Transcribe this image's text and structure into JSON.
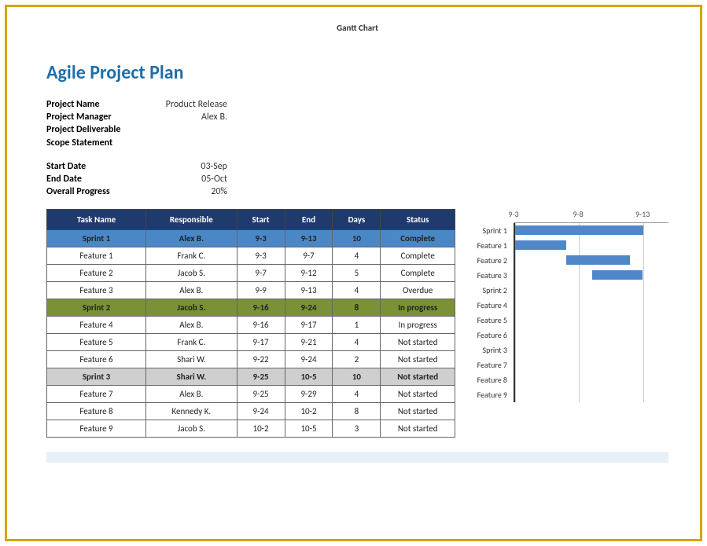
{
  "doc_title": "Gantt Chart",
  "heading": "Agile Project Plan",
  "meta1": [
    {
      "label": "Project Name",
      "value": "Product Release"
    },
    {
      "label": "Project Manager",
      "value": "Alex B."
    },
    {
      "label": "Project Deliverable",
      "value": ""
    },
    {
      "label": "Scope Statement",
      "value": ""
    }
  ],
  "meta2": [
    {
      "label": "Start Date",
      "value": "03-Sep"
    },
    {
      "label": "End Date",
      "value": "05-Oct"
    },
    {
      "label": "Overall Progress",
      "value": "20%"
    }
  ],
  "table": {
    "headers": [
      "Task Name",
      "Responsible",
      "Start",
      "End",
      "Days",
      "Status"
    ],
    "rows": [
      {
        "style": "blue",
        "cells": [
          "Sprint 1",
          "Alex B.",
          "9-3",
          "9-13",
          "10",
          "Complete"
        ]
      },
      {
        "style": "",
        "cells": [
          "Feature 1",
          "Frank C.",
          "9-3",
          "9-7",
          "4",
          "Complete"
        ]
      },
      {
        "style": "",
        "cells": [
          "Feature 2",
          "Jacob S.",
          "9-7",
          "9-12",
          "5",
          "Complete"
        ]
      },
      {
        "style": "",
        "cells": [
          "Feature 3",
          "Alex B.",
          "9-9",
          "9-13",
          "4",
          "Overdue"
        ]
      },
      {
        "style": "green",
        "cells": [
          "Sprint 2",
          "Jacob S.",
          "9-16",
          "9-24",
          "8",
          "In progress"
        ]
      },
      {
        "style": "",
        "cells": [
          "Feature 4",
          "Alex B.",
          "9-16",
          "9-17",
          "1",
          "In progress"
        ]
      },
      {
        "style": "",
        "cells": [
          "Feature 5",
          "Frank C.",
          "9-17",
          "9-21",
          "4",
          "Not started"
        ]
      },
      {
        "style": "",
        "cells": [
          "Feature 6",
          "Shari W.",
          "9-22",
          "9-24",
          "2",
          "Not started"
        ]
      },
      {
        "style": "gray",
        "cells": [
          "Sprint 3",
          "Shari W.",
          "9-25",
          "10-5",
          "10",
          "Not started"
        ]
      },
      {
        "style": "",
        "cells": [
          "Feature 7",
          "Alex B.",
          "9-25",
          "9-29",
          "4",
          "Not started"
        ]
      },
      {
        "style": "",
        "cells": [
          "Feature 8",
          "Kennedy K.",
          "9-24",
          "10-2",
          "8",
          "Not started"
        ]
      },
      {
        "style": "",
        "cells": [
          "Feature 9",
          "Jacob S.",
          "10-2",
          "10-5",
          "3",
          "Not started"
        ]
      }
    ]
  },
  "chart_data": {
    "type": "gantt",
    "x_ticks": [
      "9-3",
      "9-8",
      "9-13"
    ],
    "x_min": 3,
    "x_max": 15,
    "rows": [
      {
        "label": "Sprint 1",
        "start": 3,
        "end": 13
      },
      {
        "label": "Feature 1",
        "start": 3,
        "end": 7
      },
      {
        "label": "Feature 2",
        "start": 7,
        "end": 12
      },
      {
        "label": "Feature 3",
        "start": 9,
        "end": 13
      },
      {
        "label": "Sprint 2",
        "start": null,
        "end": null
      },
      {
        "label": "Feature 4",
        "start": null,
        "end": null
      },
      {
        "label": "Feature 5",
        "start": null,
        "end": null
      },
      {
        "label": "Feature 6",
        "start": null,
        "end": null
      },
      {
        "label": "Sprint 3",
        "start": null,
        "end": null
      },
      {
        "label": "Feature 7",
        "start": null,
        "end": null
      },
      {
        "label": "Feature 8",
        "start": null,
        "end": null
      },
      {
        "label": "Feature 9",
        "start": null,
        "end": null
      }
    ]
  }
}
